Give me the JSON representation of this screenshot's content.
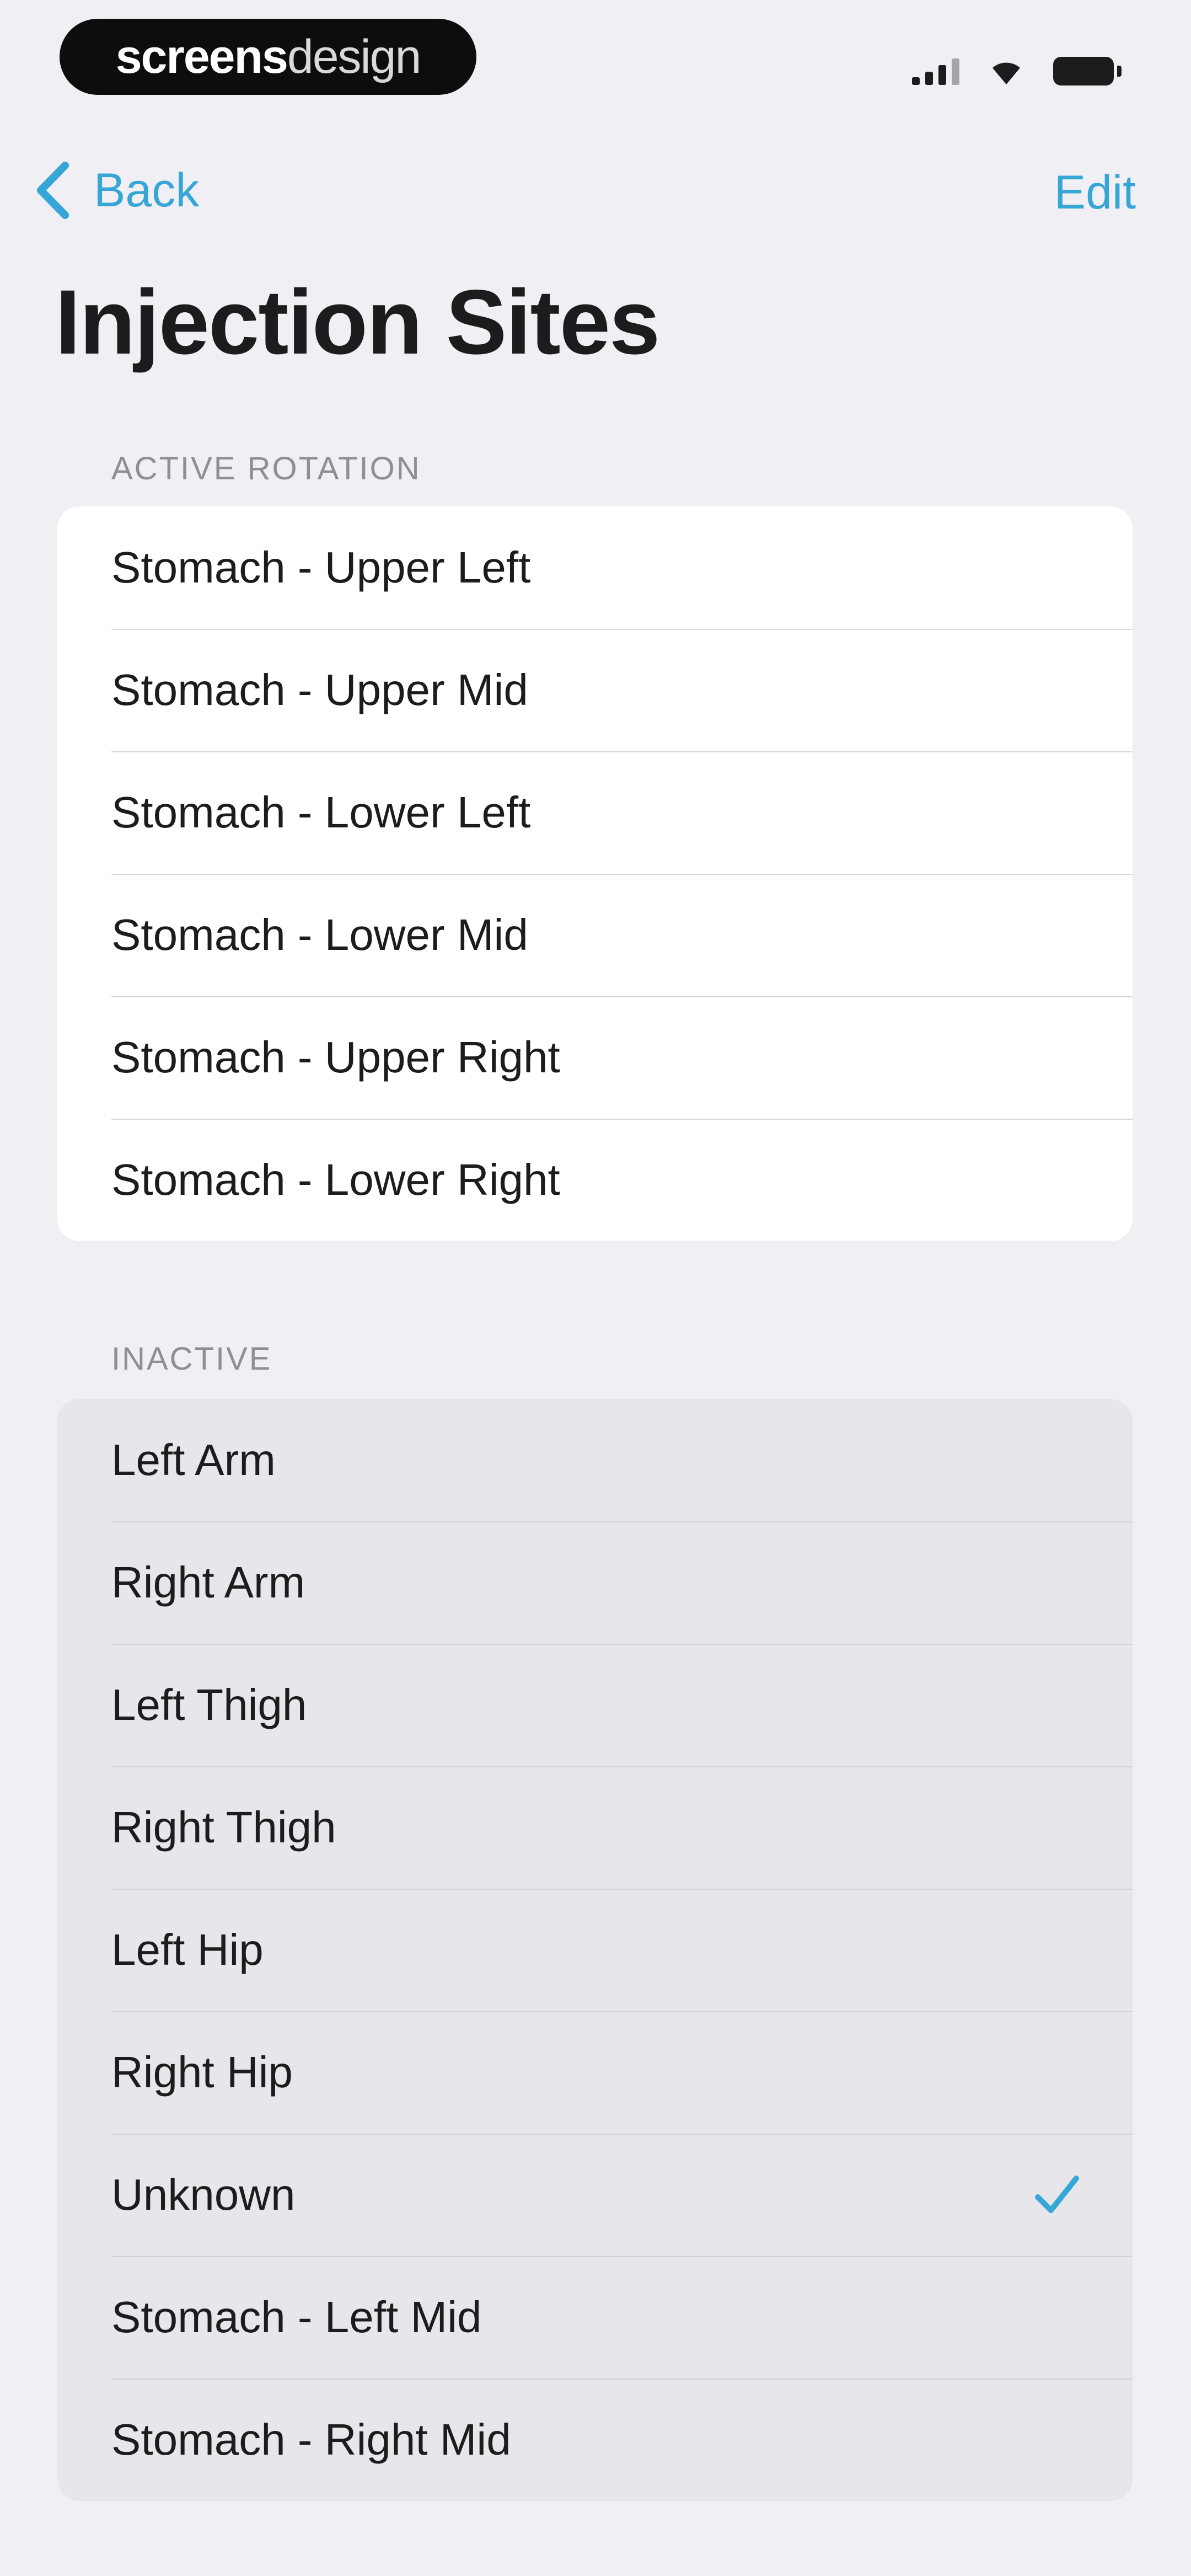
{
  "status_bar": {
    "brand_bold": "screens",
    "brand_light": "design",
    "icons": [
      "signal-icon",
      "wifi-icon",
      "battery-icon"
    ]
  },
  "nav": {
    "back_label": "Back",
    "edit_label": "Edit"
  },
  "title": "Injection Sites",
  "sections": {
    "active": {
      "header": "ACTIVE ROTATION",
      "items": [
        "Stomach - Upper Left",
        "Stomach - Upper Mid",
        "Stomach - Lower Left",
        "Stomach - Lower Mid",
        "Stomach - Upper Right",
        "Stomach - Lower Right"
      ]
    },
    "inactive": {
      "header": "INACTIVE",
      "items": [
        "Left Arm",
        "Right Arm",
        "Left Thigh",
        "Right Thigh",
        "Left Hip",
        "Right Hip",
        "Unknown",
        "Stomach - Left Mid",
        "Stomach - Right Mid"
      ],
      "selected": "Unknown"
    }
  },
  "colors": {
    "accent": "#35a6d6",
    "background": "#efeff4",
    "active_group": "#ffffff",
    "inactive_group": "#e6e6eb"
  }
}
